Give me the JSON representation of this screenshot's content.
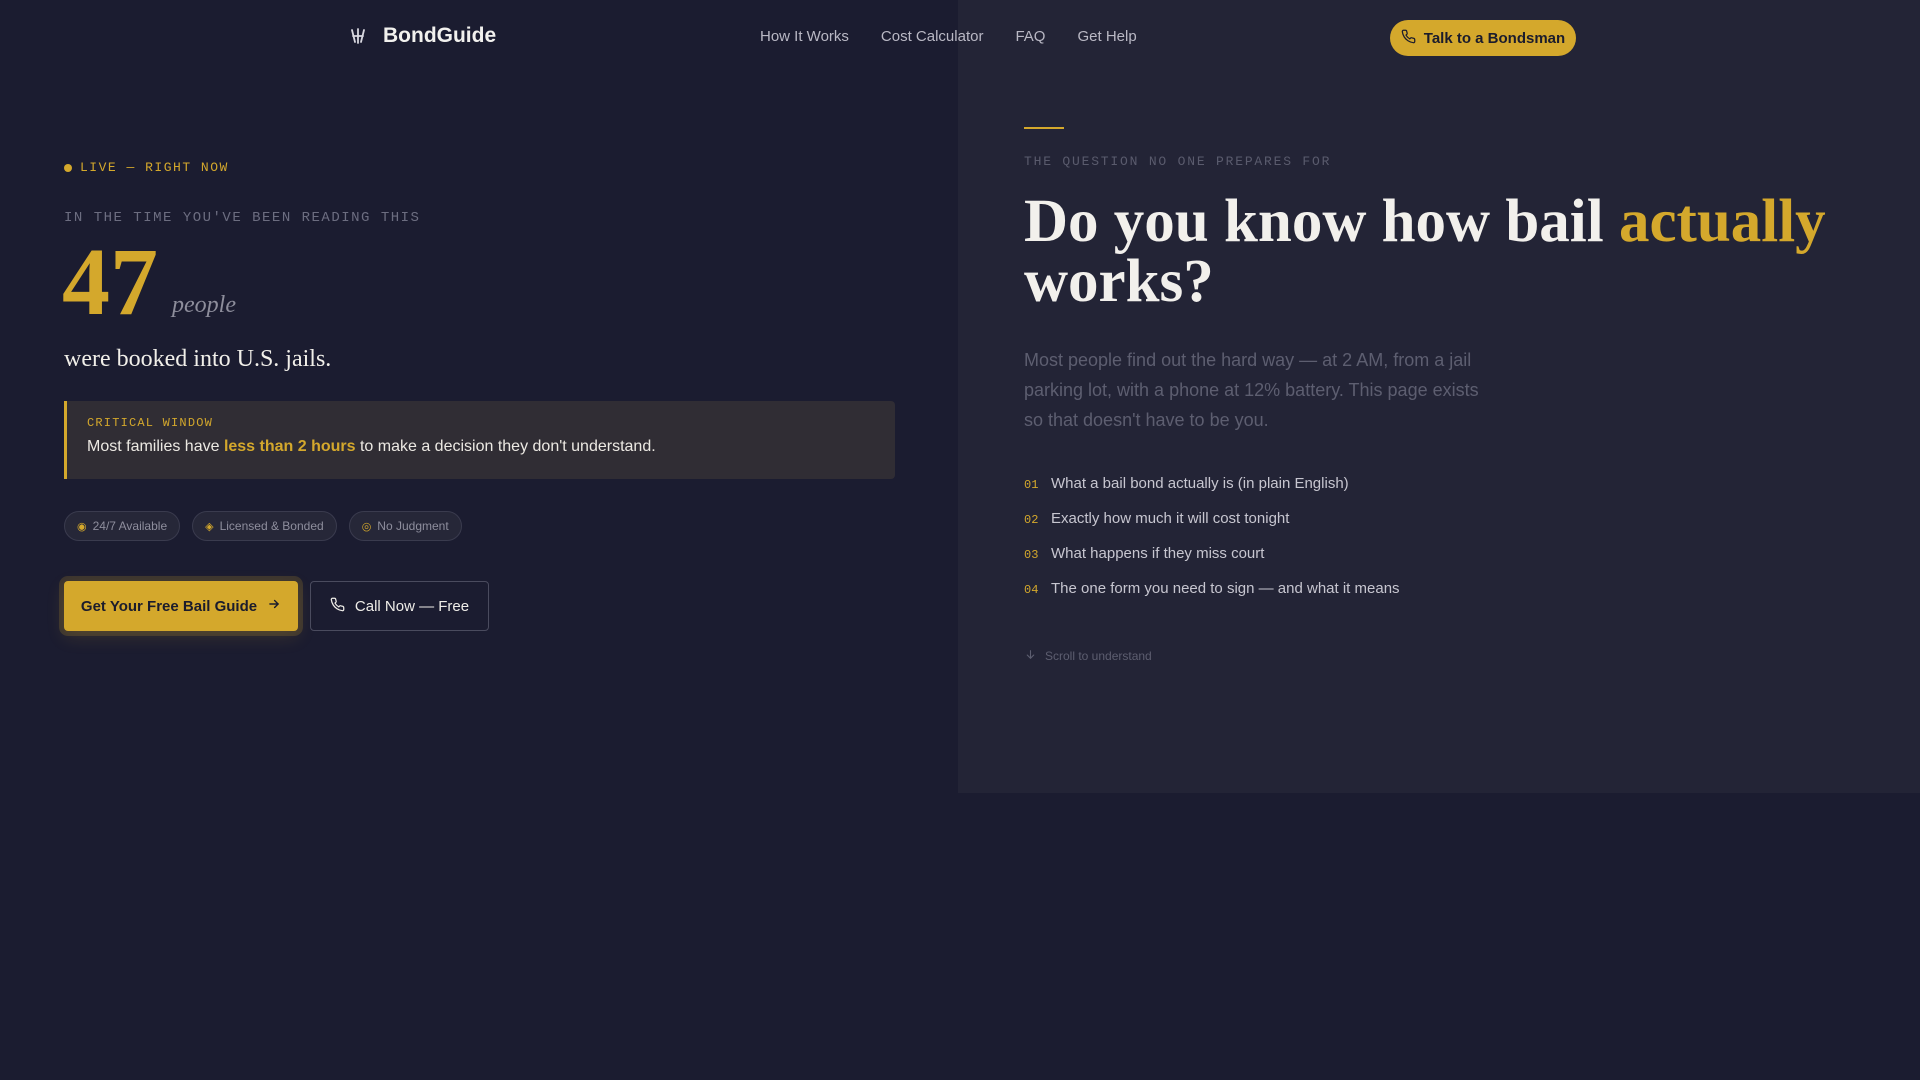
{
  "nav": {
    "brand": "BondGuide",
    "links": [
      "How It Works",
      "Cost Calculator",
      "FAQ",
      "Get Help"
    ],
    "cta": "Talk to a Bondsman",
    "icons": {
      "logo": "gavel-icon",
      "cta": "phone-icon"
    }
  },
  "hero": {
    "live_label": "LIVE — RIGHT NOW",
    "reading_label": "IN THE TIME YOU'VE BEEN READING THIS",
    "count": "47",
    "count_unit": "people",
    "booked_text": "were booked into U.S. jails.",
    "critical": {
      "label": "CRITICAL WINDOW",
      "text_before": "Most families have ",
      "highlight": "less than 2 hours",
      "text_after": " to make a decision they don't understand."
    },
    "badges": [
      {
        "icon": "circle-icon",
        "label": "24/7 Available"
      },
      {
        "icon": "diamond-icon",
        "label": "Licensed & Bonded"
      },
      {
        "icon": "ring-icon",
        "label": "No Judgment"
      }
    ],
    "primary_cta": "Get Your Free Bail Guide",
    "secondary_cta": "Call Now — Free"
  },
  "question": {
    "eyebrow": "THE QUESTION NO ONE PREPARES FOR",
    "headline_before": "Do you know how bail ",
    "headline_accent": "actually",
    "headline_after": "works?",
    "lede": "Most people find out the hard way — at 2 AM, from a jail parking lot, with a phone at 12% battery. This page exists so that doesn't have to be you.",
    "items": [
      {
        "num": "01",
        "text": "What a bail bond actually is (in plain English)"
      },
      {
        "num": "02",
        "text": "Exactly how much it will cost tonight"
      },
      {
        "num": "03",
        "text": "What happens if they miss court"
      },
      {
        "num": "04",
        "text": "The one form you need to sign — and what it means"
      }
    ],
    "scroll_label": "Scroll to understand"
  },
  "colors": {
    "background": "#1b1c30",
    "panel": "#232436",
    "accent": "#d4a82c"
  }
}
